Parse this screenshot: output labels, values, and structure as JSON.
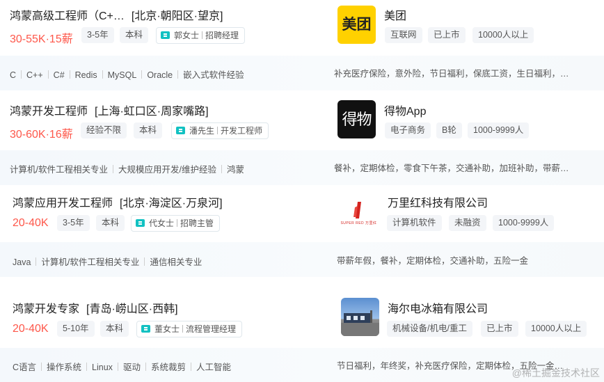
{
  "jobs": [
    {
      "title": "鸿蒙高级工程师（C+…",
      "location": "[北京·朝阳区·望京]",
      "salary": "30-55K·15薪",
      "tags": [
        "3-5年",
        "本科"
      ],
      "recruiter_name": "郭女士",
      "recruiter_role": "招聘经理",
      "company": "美团",
      "company_tags": [
        "互联网",
        "已上市",
        "10000人以上"
      ],
      "skills": [
        "C",
        "C++",
        "C#",
        "Redis",
        "MySQL",
        "Oracle",
        "嵌入式软件经验"
      ],
      "welfare": "补充医疗保险，意外险，节日福利，保底工资，生日福利，…",
      "logo": {
        "text": "美团",
        "bg": "#ffd100",
        "fg": "#222222"
      }
    },
    {
      "title": "鸿蒙开发工程师",
      "location": "[上海·虹口区·周家嘴路]",
      "salary": "30-60K·16薪",
      "tags": [
        "经验不限",
        "本科"
      ],
      "recruiter_name": "潘先生",
      "recruiter_role": "开发工程师",
      "company": "得物App",
      "company_tags": [
        "电子商务",
        "B轮",
        "1000-9999人"
      ],
      "skills": [
        "计算机/软件工程相关专业",
        "大规模应用开发/维护经验",
        "鸿蒙"
      ],
      "welfare": "餐补，定期体检，零食下午茶，交通补助，加班补助，带薪…",
      "logo": {
        "text": "得物",
        "bg": "#111111",
        "fg": "#ffffff"
      }
    },
    {
      "title": "鸿蒙应用开发工程师",
      "location": "[北京·海淀区·万泉河]",
      "salary": "20-40K",
      "tags": [
        "3-5年",
        "本科"
      ],
      "recruiter_name": "代女士",
      "recruiter_role": "招聘主管",
      "company": "万里红科技有限公司",
      "company_tags": [
        "计算机软件",
        "未融资",
        "1000-9999人"
      ],
      "skills": [
        "Java",
        "计算机/软件工程相关专业",
        "通信相关专业"
      ],
      "welfare": "带薪年假，餐补，定期体检，交通补助，五险一金",
      "logo": {
        "text": "SUPER RED 万里红",
        "bg": "#ffffff",
        "fg": "#d4231f"
      }
    },
    {
      "title": "鸿蒙开发专家",
      "location": "[青岛·崂山区·西韩]",
      "salary": "20-40K",
      "tags": [
        "5-10年",
        "本科"
      ],
      "recruiter_name": "董女士",
      "recruiter_role": "流程管理经理",
      "company": "海尔电冰箱有限公司",
      "company_tags": [
        "机械设备/机电/重工",
        "已上市",
        "10000人以上"
      ],
      "skills": [
        "C语言",
        "操作系统",
        "Linux",
        "驱动",
        "系统裁剪",
        "人工智能"
      ],
      "welfare": "节日福利，年终奖，补充医疗保险，定期体检，五险一金…",
      "logo": {
        "text": "",
        "bg": "#6fa0d8",
        "fg": "#ffffff"
      }
    }
  ],
  "watermark": "@稀土掘金技术社区"
}
